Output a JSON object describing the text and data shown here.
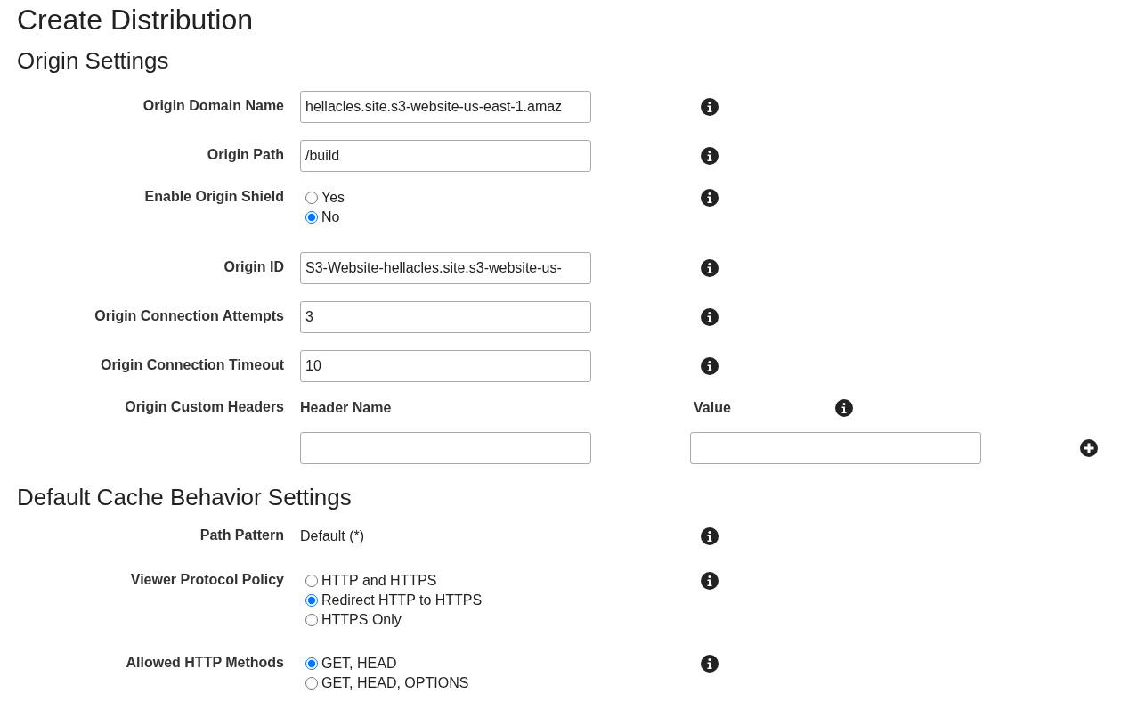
{
  "title": "Create Distribution",
  "sections": [
    {
      "heading": "Origin Settings",
      "rows": [
        {
          "kind": "text",
          "label": "Origin Domain Name",
          "value": "hellacles.site.s3-website-us-east-1.amaz"
        },
        {
          "kind": "text",
          "label": "Origin Path",
          "value": "/build"
        },
        {
          "kind": "radio",
          "label": "Enable Origin Shield",
          "options": [
            {
              "label": "Yes",
              "selected": false
            },
            {
              "label": "No",
              "selected": true
            }
          ]
        },
        {
          "kind": "text",
          "label": "Origin ID",
          "value": "S3-Website-hellacles.site.s3-website-us-"
        },
        {
          "kind": "text",
          "label": "Origin Connection Attempts",
          "value": "3"
        },
        {
          "kind": "text",
          "label": "Origin Connection Timeout",
          "value": "10"
        },
        {
          "kind": "headers",
          "label": "Origin Custom Headers",
          "columns": [
            "Header Name",
            "Value"
          ]
        }
      ]
    },
    {
      "heading": "Default Cache Behavior Settings",
      "rows": [
        {
          "kind": "static",
          "label": "Path Pattern",
          "value": "Default (*)"
        },
        {
          "kind": "radio",
          "label": "Viewer Protocol Policy",
          "options": [
            {
              "label": "HTTP and HTTPS",
              "selected": false
            },
            {
              "label": "Redirect HTTP to HTTPS",
              "selected": true
            },
            {
              "label": "HTTPS Only",
              "selected": false
            }
          ]
        },
        {
          "kind": "radio",
          "label": "Allowed HTTP Methods",
          "options": [
            {
              "label": "GET, HEAD",
              "selected": true
            },
            {
              "label": "GET, HEAD, OPTIONS",
              "selected": false
            }
          ]
        }
      ]
    }
  ]
}
